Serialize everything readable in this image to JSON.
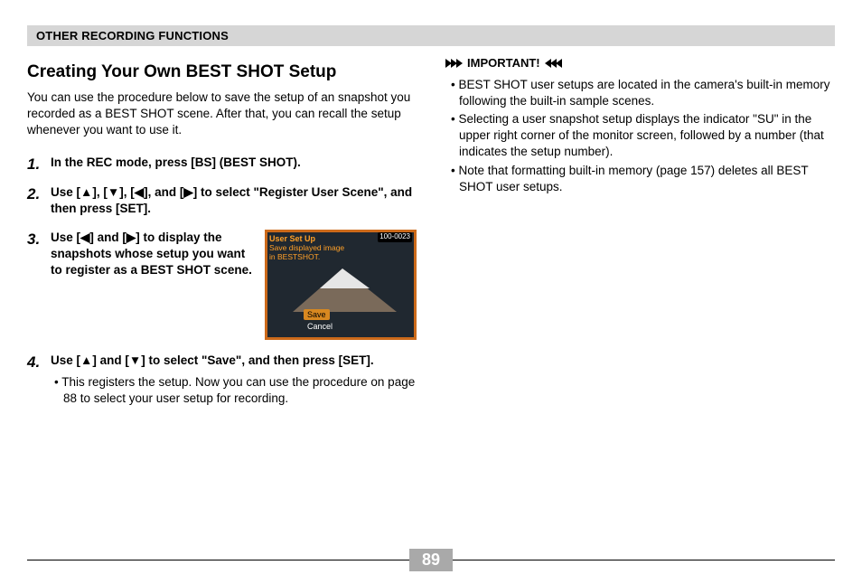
{
  "header": "OTHER RECORDING FUNCTIONS",
  "section_title": "Creating Your Own BEST SHOT Setup",
  "intro": "You can use the procedure below to save the setup of an snapshot you recorded as a BEST SHOT scene. After that, you can recall the setup whenever you want to use it.",
  "steps": {
    "s1": "In the REC mode, press [BS] (BEST SHOT).",
    "s2": "Use [▲], [▼], [◀], and [▶] to select \"Register User Scene\", and then press [SET].",
    "s3": "Use [◀] and [▶] to display the snapshots whose setup you want to register as a BEST SHOT scene.",
    "s4": "Use [▲] and [▼] to select \"Save\", and then press [SET].",
    "s4_sub": "This registers the setup. Now you can use the procedure on page 88 to select your user setup for recording."
  },
  "camera_screen": {
    "title": "User Set Up",
    "counter": "100-0023",
    "line2": "Save displayed image",
    "line3": "in BESTSHOT.",
    "option_save": "Save",
    "option_cancel": "Cancel"
  },
  "important_label": "IMPORTANT!",
  "important": {
    "b1": "BEST SHOT user setups are located in the camera's built-in memory following the built-in sample scenes.",
    "b2": "Selecting a user snapshot setup displays the indicator \"SU\" in the upper right corner of the monitor screen, followed by a number (that indicates the setup number).",
    "b3": "Note that formatting built-in memory (page 157) deletes all BEST SHOT user setups."
  },
  "page_number": "89"
}
